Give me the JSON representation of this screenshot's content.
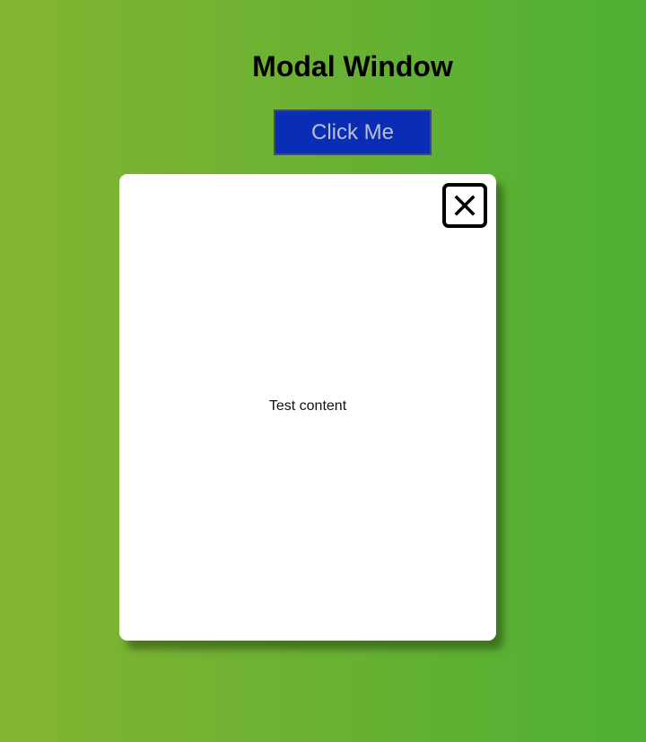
{
  "page": {
    "title": "Modal Window"
  },
  "trigger_button": {
    "label": "Click Me"
  },
  "modal": {
    "content": "Test content",
    "close_icon": "close-icon"
  },
  "colors": {
    "background_gradient_left": "#84b432",
    "background_gradient_right": "#4db032",
    "button_background": "#0a2db5",
    "button_text": "#b9c0d8",
    "modal_background": "#ffffff"
  }
}
